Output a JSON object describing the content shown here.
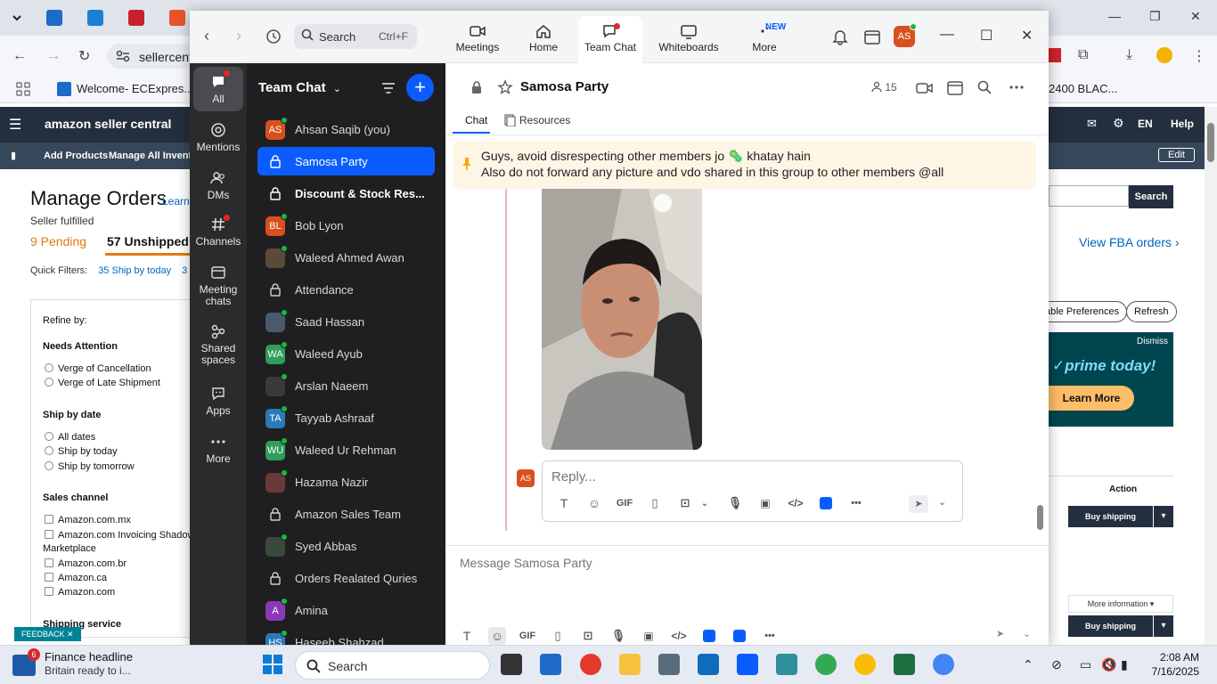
{
  "browser": {
    "address_partial": "sellercent",
    "bookmark_label": "Welcome- ECExpres...",
    "bookmark_right": "2400 BLAC..."
  },
  "amazon": {
    "logo": "amazon seller central",
    "nav": [
      "Add Products",
      "Manage All Inventory"
    ],
    "lang": "EN",
    "help": "Help",
    "edit": "Edit",
    "title": "Manage Orders",
    "learn": "Learn",
    "seller_fulfilled": "Seller fulfilled",
    "pending": "9 Pending",
    "unshipped": "57 Unshipped",
    "quick_filters_label": "Quick Filters:",
    "quick_filter_1": "35 Ship by today",
    "quick_filter_2": "3",
    "refine": {
      "title": "Refine by:",
      "needs_attention": "Needs Attention",
      "na_options": [
        "Verge of Cancellation",
        "Verge of Late Shipment"
      ],
      "ship_by_date": "Ship by date",
      "sbd_options": [
        "All dates",
        "Ship by today",
        "Ship by tomorrow"
      ],
      "sales_channel": "Sales channel",
      "sc_options": [
        "Amazon.com.mx",
        "Amazon.com Invoicing Shadow",
        "Marketplace",
        "Amazon.com.br",
        "Amazon.ca",
        "Amazon.com"
      ],
      "shipping_service": "Shipping service"
    },
    "feedback": "FEEDBACK",
    "search_btn": "Search",
    "view_fba": "View FBA orders ›",
    "pill_prefs": "able Preferences",
    "pill_refresh": "Refresh",
    "prime_dismiss": "Dismiss",
    "prime_text": "✓prime today!",
    "prime_learn": "Learn More",
    "action_header": "Action",
    "buy_shipping": "Buy shipping",
    "more_info": "More information ▾"
  },
  "zoom": {
    "search_label": "Search",
    "search_shortcut": "Ctrl+F",
    "tabs": [
      {
        "label": "Meetings"
      },
      {
        "label": "Home"
      },
      {
        "label": "Team Chat"
      },
      {
        "label": "Whiteboards"
      },
      {
        "label": "More",
        "badge": "NEW"
      }
    ],
    "avatar_initials": "AS",
    "rail": [
      {
        "label": "All"
      },
      {
        "label": "Mentions"
      },
      {
        "label": "DMs"
      },
      {
        "label": "Channels"
      },
      {
        "label": "Meeting chats"
      },
      {
        "label": "Shared spaces"
      },
      {
        "label": "Apps"
      },
      {
        "label": "More"
      }
    ],
    "chat_list": {
      "header": "Team Chat",
      "items": [
        {
          "name": "Ahsan Saqib (you)",
          "initials": "AS",
          "color": "#d8501f"
        },
        {
          "name": "Samosa Party",
          "initials": "",
          "color": ""
        },
        {
          "name": "Discount & Stock Res...",
          "initials": "",
          "color": ""
        },
        {
          "name": "Bob Lyon",
          "initials": "BL",
          "color": "#d8501f"
        },
        {
          "name": "Waleed Ahmed Awan",
          "initials": "",
          "color": "#5a4a3a"
        },
        {
          "name": "Attendance",
          "initials": "",
          "color": ""
        },
        {
          "name": "Saad Hassan",
          "initials": "",
          "color": "#4a5a6a"
        },
        {
          "name": "Waleed Ayub",
          "initials": "WA",
          "color": "#2f9e5a"
        },
        {
          "name": "Arslan Naeem",
          "initials": "",
          "color": "#3a3a3a"
        },
        {
          "name": "Tayyab Ashraaf",
          "initials": "TA",
          "color": "#2a7ab8"
        },
        {
          "name": "Waleed Ur Rehman",
          "initials": "WU",
          "color": "#2f9e5a"
        },
        {
          "name": "Hazama Nazir",
          "initials": "",
          "color": "#6a3a3a"
        },
        {
          "name": "Amazon Sales Team",
          "initials": "",
          "color": ""
        },
        {
          "name": "Syed Abbas",
          "initials": "",
          "color": "#3a4a3a"
        },
        {
          "name": "Orders Realated Quries",
          "initials": "",
          "color": ""
        },
        {
          "name": "Amina",
          "initials": "A",
          "color": "#8a3ab8"
        },
        {
          "name": "Haseeb Shahzad",
          "initials": "HS",
          "color": "#2a7ab8"
        }
      ]
    },
    "chat": {
      "title": "Samosa Party",
      "members": "15",
      "tab_chat": "Chat",
      "tab_resources": "Resources",
      "pinned_line1": "Guys, avoid disrespecting other members jo 🦠 khatay hain",
      "pinned_line2": "Also do not forward any picture and vdo shared in this group to other members @all",
      "reply_avatar": "AS",
      "reply_placeholder": "Reply...",
      "gif": "GIF",
      "message_placeholder": "Message Samosa Party"
    }
  },
  "taskbar": {
    "news_badge": "6",
    "news_title": "Finance headline",
    "news_sub": "Britain ready to i...",
    "search": "Search",
    "time": "2:08 AM",
    "date": "7/16/2025"
  }
}
